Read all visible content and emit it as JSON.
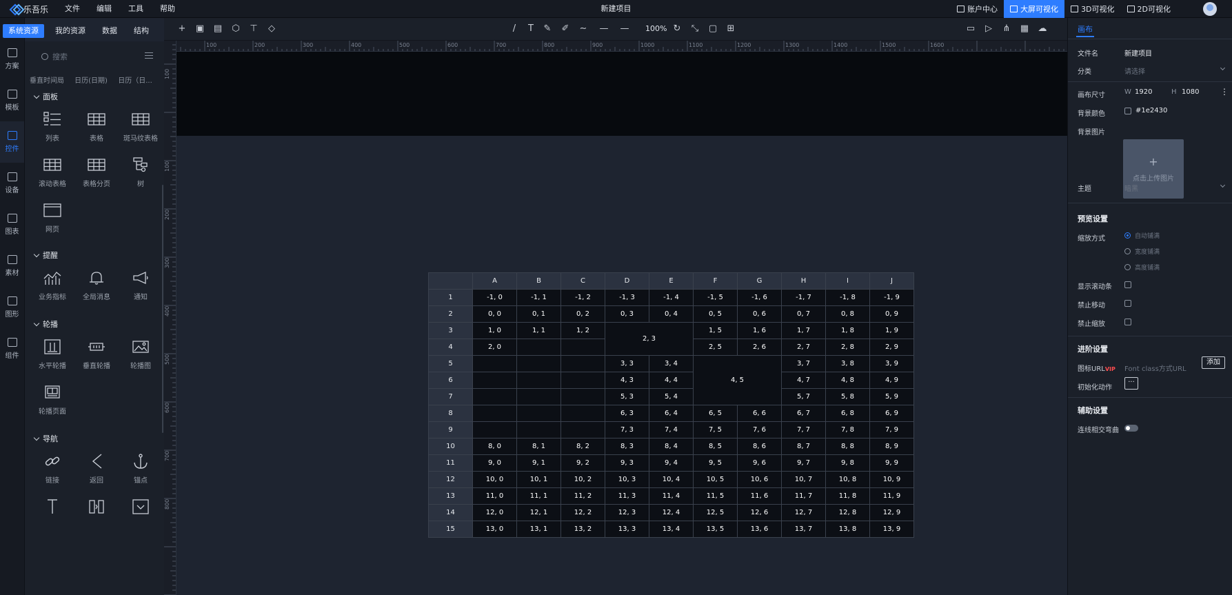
{
  "app": {
    "name": "乐吾乐",
    "project_title": "新建项目"
  },
  "menu": [
    "文件",
    "编辑",
    "工具",
    "帮助"
  ],
  "top_right": [
    {
      "label": "账户中心",
      "icon": "home-icon"
    },
    {
      "label": "大屏可视化",
      "icon": "monitor-icon",
      "active": true
    },
    {
      "label": "3D可视化",
      "icon": "cube-icon"
    },
    {
      "label": "2D可视化",
      "icon": "grid-icon"
    }
  ],
  "resource_tabs": [
    "系统资源",
    "我的资源",
    "数据",
    "结构"
  ],
  "rail": [
    {
      "label": "方案",
      "icon": "monitor-icon"
    },
    {
      "label": "模板",
      "icon": "template-icon"
    },
    {
      "label": "控件",
      "icon": "components-icon",
      "active": true
    },
    {
      "label": "设备",
      "icon": "cube-icon"
    },
    {
      "label": "图表",
      "icon": "chart-icon"
    },
    {
      "label": "素材",
      "icon": "image-icon"
    },
    {
      "label": "图形",
      "icon": "shapes-icon"
    },
    {
      "label": "组件",
      "icon": "package-icon"
    }
  ],
  "search_placeholder": "搜索",
  "cut_row": [
    "垂直时间局",
    "日历(日期)",
    "日历（日..."
  ],
  "sections": [
    {
      "title": "面板",
      "items": [
        {
          "label": "列表",
          "icon": "list-icon"
        },
        {
          "label": "表格",
          "icon": "table-icon"
        },
        {
          "label": "斑马纹表格",
          "icon": "table-icon"
        },
        {
          "label": "滚动表格",
          "icon": "table-icon"
        },
        {
          "label": "表格分页",
          "icon": "table-icon"
        },
        {
          "label": "树",
          "icon": "tree-icon"
        },
        {
          "label": "网页",
          "icon": "browser-icon"
        }
      ]
    },
    {
      "title": "提醒",
      "items": [
        {
          "label": "业务指标",
          "icon": "trend-icon"
        },
        {
          "label": "全局消息",
          "icon": "bell-icon"
        },
        {
          "label": "通知",
          "icon": "megaphone-icon"
        }
      ]
    },
    {
      "title": "轮播",
      "items": [
        {
          "label": "水平轮播",
          "icon": "carousel-h-icon"
        },
        {
          "label": "垂直轮播",
          "icon": "carousel-v-icon"
        },
        {
          "label": "轮播图",
          "icon": "image-carousel-icon"
        },
        {
          "label": "轮播页面",
          "icon": "page-carousel-icon"
        }
      ]
    },
    {
      "title": "导航",
      "items": [
        {
          "label": "链接",
          "icon": "link-icon"
        },
        {
          "label": "返回",
          "icon": "back-icon"
        },
        {
          "label": "锚点",
          "icon": "anchor-icon"
        }
      ]
    }
  ],
  "toolbar": {
    "zoom": "100%"
  },
  "ruler_top": [
    "100",
    "200",
    "300",
    "400",
    "500",
    "600",
    "700",
    "800",
    "900",
    "1000",
    "1100",
    "1200",
    "1300",
    "1400",
    "1500",
    "1600"
  ],
  "ruler_left": [
    "100",
    "100",
    "200",
    "300",
    "400",
    "500",
    "600",
    "700",
    "800"
  ],
  "table": {
    "columns": [
      "A",
      "B",
      "C",
      "D",
      "E",
      "F",
      "G",
      "H",
      "I",
      "J"
    ],
    "rows": [
      "1",
      "2",
      "3",
      "4",
      "5",
      "6",
      "7",
      "8",
      "9",
      "10",
      "11",
      "12",
      "13",
      "14",
      "15"
    ],
    "merged_a": "2, 3",
    "merged_b": "4, 5"
  },
  "right_panel": {
    "tab": "画布",
    "file_name_label": "文件名",
    "file_name": "新建项目",
    "category_label": "分类",
    "category_placeholder": "请选择",
    "canvas_size_label": "画布尺寸",
    "w_label": "W",
    "w": "1920",
    "h_label": "H",
    "h": "1080",
    "bg_color_label": "背景颜色",
    "bg_color": "#1e2430",
    "bg_image_label": "背景图片",
    "upload_text": "点击上传图片",
    "theme_label": "主题",
    "theme_value": "暗黑",
    "preview_section": "预览设置",
    "scale_label": "缩放方式",
    "scale_options": [
      "自动铺满",
      "宽度铺满",
      "高度铺满"
    ],
    "show_scrollbar_label": "显示滚动条",
    "no_move_label": "禁止移动",
    "no_zoom_label": "禁止缩放",
    "advanced_section": "进阶设置",
    "icon_url_label": "图标URL",
    "vip": "VIP",
    "icon_url_placeholder": "Font class方式URL",
    "add_button": "添加",
    "init_action_label": "初始化动作",
    "more": "···",
    "aux_section": "辅助设置",
    "curve_label": "连线相交弯曲"
  }
}
